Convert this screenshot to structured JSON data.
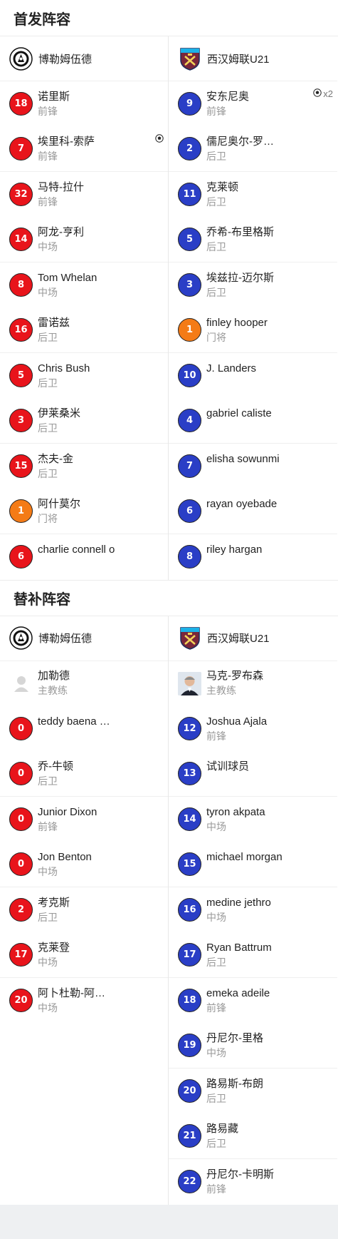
{
  "starting": {
    "title": "首发阵容",
    "home_team": "博勒姆伍德",
    "away_team": "西汉姆联U21",
    "home_players": [
      {
        "number": "18",
        "name": "诺里斯",
        "position": "前锋",
        "color": "red"
      },
      {
        "number": "7",
        "name": "埃里科-索萨",
        "position": "前锋",
        "color": "red",
        "event": "goal"
      },
      {
        "number": "32",
        "name": "马特-拉什",
        "position": "前锋",
        "color": "red"
      },
      {
        "number": "14",
        "name": "阿龙-亨利",
        "position": "中场",
        "color": "red"
      },
      {
        "number": "8",
        "name": "Tom Whelan",
        "position": "中场",
        "color": "red"
      },
      {
        "number": "16",
        "name": "雷诺兹",
        "position": "后卫",
        "color": "red"
      },
      {
        "number": "5",
        "name": "Chris Bush",
        "position": "后卫",
        "color": "red"
      },
      {
        "number": "3",
        "name": "伊莱桑米",
        "position": "后卫",
        "color": "red"
      },
      {
        "number": "15",
        "name": "杰夫-金",
        "position": "后卫",
        "color": "red"
      },
      {
        "number": "1",
        "name": "阿什莫尔",
        "position": "门将",
        "color": "orange"
      },
      {
        "number": "6",
        "name": "charlie connell o",
        "position": "",
        "color": "red"
      }
    ],
    "away_players": [
      {
        "number": "9",
        "name": "安东尼奥",
        "position": "前锋",
        "color": "blue",
        "event": "goal",
        "event_count": "x2"
      },
      {
        "number": "2",
        "name": "儒尼奥尔-罗…",
        "position": "后卫",
        "color": "blue"
      },
      {
        "number": "11",
        "name": "克莱顿",
        "position": "后卫",
        "color": "blue"
      },
      {
        "number": "5",
        "name": "乔希-布里格斯",
        "position": "后卫",
        "color": "blue"
      },
      {
        "number": "3",
        "name": "埃兹拉-迈尔斯",
        "position": "后卫",
        "color": "blue"
      },
      {
        "number": "1",
        "name": "finley hooper",
        "position": "门将",
        "color": "orange"
      },
      {
        "number": "10",
        "name": "J. Landers",
        "position": "",
        "color": "blue"
      },
      {
        "number": "4",
        "name": "gabriel caliste",
        "position": "",
        "color": "blue"
      },
      {
        "number": "7",
        "name": "elisha sowunmi",
        "position": "",
        "color": "blue"
      },
      {
        "number": "6",
        "name": "rayan oyebade",
        "position": "",
        "color": "blue"
      },
      {
        "number": "8",
        "name": "riley hargan",
        "position": "",
        "color": "blue"
      }
    ]
  },
  "subs": {
    "title": "替补阵容",
    "home_team": "博勒姆伍德",
    "away_team": "西汉姆联U21",
    "home_coach": {
      "name": "加勒德",
      "role": "主教练"
    },
    "away_coach": {
      "name": "马克-罗布森",
      "role": "主教练"
    },
    "home_players": [
      {
        "number": "0",
        "name": "teddy baena …",
        "position": "",
        "color": "red"
      },
      {
        "number": "0",
        "name": "乔-牛顿",
        "position": "后卫",
        "color": "red"
      },
      {
        "number": "0",
        "name": "Junior Dixon",
        "position": "前锋",
        "color": "red"
      },
      {
        "number": "0",
        "name": "Jon Benton",
        "position": "中场",
        "color": "red"
      },
      {
        "number": "2",
        "name": "考克斯",
        "position": "后卫",
        "color": "red"
      },
      {
        "number": "17",
        "name": "克莱登",
        "position": "中场",
        "color": "red"
      },
      {
        "number": "20",
        "name": "阿卜杜勒-阿…",
        "position": "中场",
        "color": "red"
      }
    ],
    "away_players": [
      {
        "number": "12",
        "name": "Joshua Ajala",
        "position": "前锋",
        "color": "blue"
      },
      {
        "number": "13",
        "name": "试训球员",
        "position": "",
        "color": "blue"
      },
      {
        "number": "14",
        "name": "tyron akpata",
        "position": "中场",
        "color": "blue"
      },
      {
        "number": "15",
        "name": "michael morgan",
        "position": "",
        "color": "blue"
      },
      {
        "number": "16",
        "name": "medine jethro",
        "position": "中场",
        "color": "blue"
      },
      {
        "number": "17",
        "name": "Ryan Battrum",
        "position": "后卫",
        "color": "blue"
      },
      {
        "number": "18",
        "name": "emeka adeile",
        "position": "前锋",
        "color": "blue"
      },
      {
        "number": "19",
        "name": "丹尼尔-里格",
        "position": "中场",
        "color": "blue"
      },
      {
        "number": "20",
        "name": "路易斯-布朗",
        "position": "后卫",
        "color": "blue"
      },
      {
        "number": "21",
        "name": "路易藏",
        "position": "后卫",
        "color": "blue"
      },
      {
        "number": "22",
        "name": "丹尼尔-卡明斯",
        "position": "前锋",
        "color": "blue"
      }
    ]
  },
  "colors": {
    "home": "#e8141b",
    "away": "#2a3ec6",
    "goalkeeper": "#f47b16"
  },
  "icons": {
    "home_logo": "borehamwood-crest-icon",
    "away_logo": "west-ham-crest-icon",
    "goal": "football-icon",
    "coach_placeholder": "person-placeholder-icon"
  }
}
